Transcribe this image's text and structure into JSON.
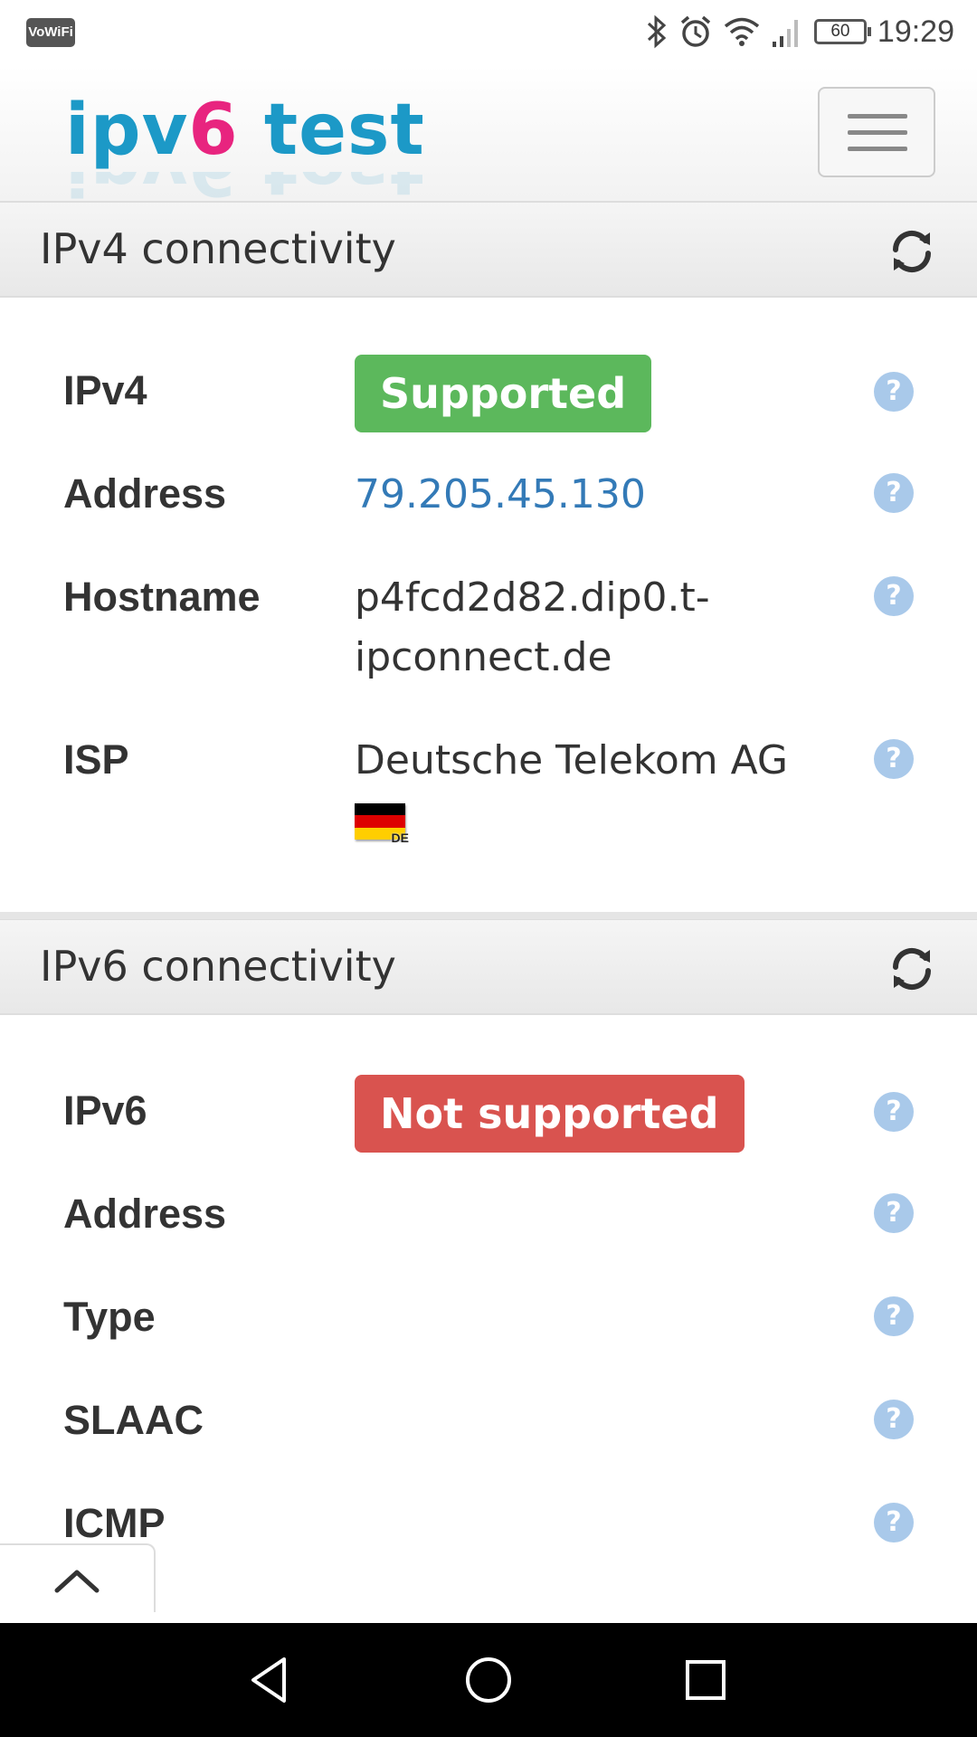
{
  "status_bar": {
    "carrier_badge": "VoWiFi",
    "battery": "60",
    "time": "19:29",
    "icons": [
      "bluetooth-icon",
      "alarm-icon",
      "wifi-icon",
      "signal-icon",
      "battery-icon"
    ]
  },
  "header": {
    "logo_part1": "ipv",
    "logo_part2": "6",
    "logo_part3": " test",
    "menu_icon": "hamburger-icon"
  },
  "ipv4": {
    "title": "IPv4 connectivity",
    "rows": {
      "ipv4": {
        "label": "IPv4",
        "badge": "Supported"
      },
      "address": {
        "label": "Address",
        "value": "79.205.45.130"
      },
      "hostname": {
        "label": "Hostname",
        "value_line1": "p4fcd2d82.dip0.t-",
        "value_line2": "ipconnect.de"
      },
      "isp": {
        "label": "ISP",
        "value": "Deutsche Telekom AG",
        "country_code": "DE"
      }
    }
  },
  "ipv6": {
    "title": "IPv6 connectivity",
    "rows": {
      "ipv6": {
        "label": "IPv6",
        "badge": "Not supported"
      },
      "address": {
        "label": "Address"
      },
      "type": {
        "label": "Type"
      },
      "slaac": {
        "label": "SLAAC"
      },
      "icmp": {
        "label": "ICMP"
      }
    }
  },
  "help_glyph": "?",
  "colors": {
    "supported": "#5cb85c",
    "not_supported": "#d9534f",
    "link": "#337ab7",
    "help": "#a9c9ea",
    "logo_blue": "#1c99c7",
    "logo_pink": "#e8247f"
  }
}
